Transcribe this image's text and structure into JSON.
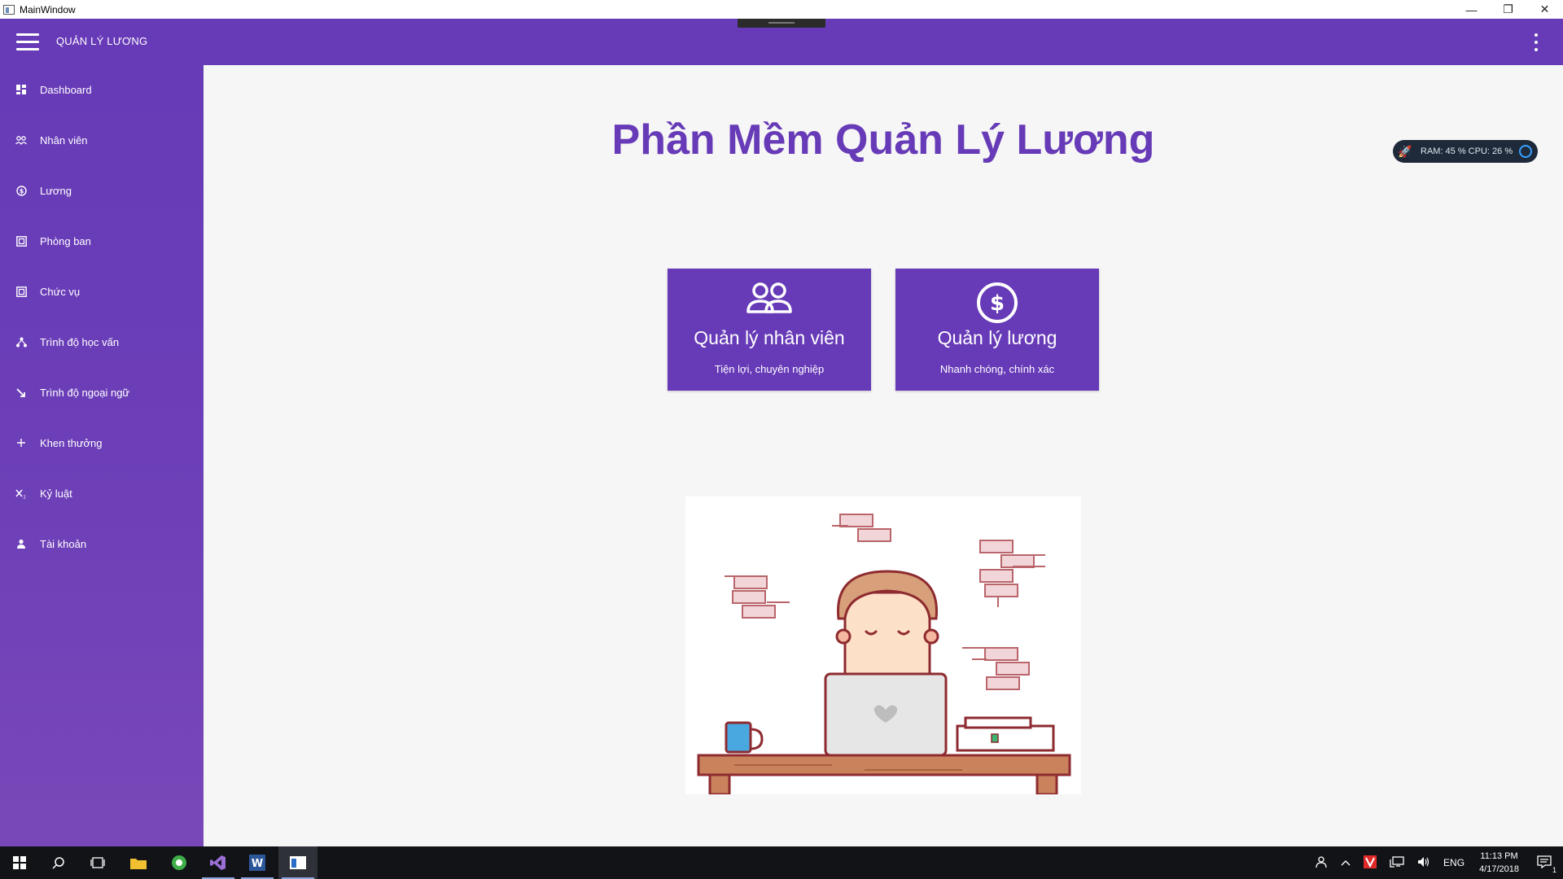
{
  "window": {
    "title": "MainWindow",
    "minimize_glyph": "—",
    "restore_glyph": "❐",
    "close_glyph": "✕"
  },
  "appbar": {
    "title": "QUẢN LÝ LƯƠNG"
  },
  "sidebar": {
    "items": [
      {
        "label": "Dashboard",
        "icon": "dashboard-icon"
      },
      {
        "label": "Nhân viên",
        "icon": "people-icon"
      },
      {
        "label": "Lương",
        "icon": "dollar-circle-icon"
      },
      {
        "label": "Phòng ban",
        "icon": "building-icon"
      },
      {
        "label": "Chức vụ",
        "icon": "building-icon"
      },
      {
        "label": "Trình độ học vấn",
        "icon": "hierarchy-icon"
      },
      {
        "label": "Trình độ ngoại ngữ",
        "icon": "arrow-down-right-icon"
      },
      {
        "label": "Khen thưởng",
        "icon": "plus-icon"
      },
      {
        "label": "Kỷ luật",
        "icon": "subscript-x-icon"
      },
      {
        "label": "Tài khoản",
        "icon": "user-icon"
      }
    ]
  },
  "main": {
    "title": "Phần Mềm Quản Lý Lương",
    "cards": [
      {
        "title": "Quản lý nhân viên",
        "subtitle": "Tiện lợi, chuyên nghiệp",
        "icon": "people-icon"
      },
      {
        "title": "Quản lý lương",
        "subtitle": "Nhanh chóng, chính xác",
        "icon": "dollar-circle-icon"
      }
    ],
    "illustration": "person-working-on-laptop-illustration"
  },
  "system_monitor": {
    "text": "RAM: 45 %  CPU: 26 %"
  },
  "taskbar": {
    "language": "ENG",
    "time": "11:13 PM",
    "date": "4/17/2018",
    "notification_count": "1"
  },
  "colors": {
    "primary": "#673ab7",
    "background": "#f6f6f6",
    "taskbar": "#111317"
  }
}
